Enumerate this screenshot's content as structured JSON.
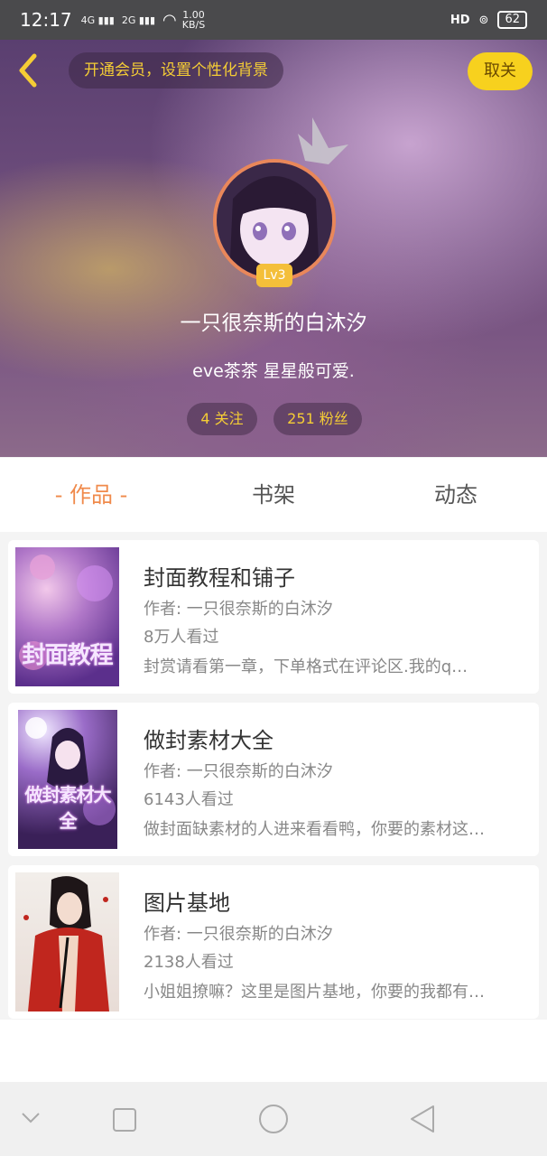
{
  "status_bar": {
    "time": "12:17",
    "net1": "4G",
    "net2": "2G",
    "speed_top": "1.00",
    "speed_unit": "KB/S",
    "hd": "HD",
    "battery": "62"
  },
  "header": {
    "vip_prompt": "开通会员，设置个性化背景",
    "unfollow_label": "取关"
  },
  "profile": {
    "level": "Lv3",
    "name": "一只很奈斯的白沐汐",
    "signature": "eve茶茶 星星般可爱.",
    "following": "4 关注",
    "fans": "251 粉丝"
  },
  "tabs": [
    {
      "label": "- 作品 -",
      "active": true
    },
    {
      "label": "书架",
      "active": false
    },
    {
      "label": "动态",
      "active": false
    }
  ],
  "works": [
    {
      "title": "封面教程和铺子",
      "author": "作者: 一只很奈斯的白沐汐",
      "views": "8万人看过",
      "desc": "封赏请看第一章，下单格式在评论区.我的q…",
      "cover_text": "封面教程"
    },
    {
      "title": "做封素材大全",
      "author": "作者: 一只很奈斯的白沐汐",
      "views": "6143人看过",
      "desc": "做封面缺素材的人进来看看鸭，你要的素材这…",
      "cover_text": "做封素材大全"
    },
    {
      "title": "图片基地",
      "author": "作者: 一只很奈斯的白沐汐",
      "views": "2138人看过",
      "desc": "小姐姐撩嘛？这里是图片基地，你要的我都有…",
      "cover_text": ""
    }
  ],
  "colors": {
    "accent": "#f08a4b",
    "gold": "#f5cd35",
    "yellow_button": "#f7d11e"
  },
  "icons": [
    "back-arrow-icon",
    "crown-icon",
    "nav-back-icon",
    "nav-home-icon",
    "nav-recents-icon",
    "nav-collapse-icon"
  ]
}
